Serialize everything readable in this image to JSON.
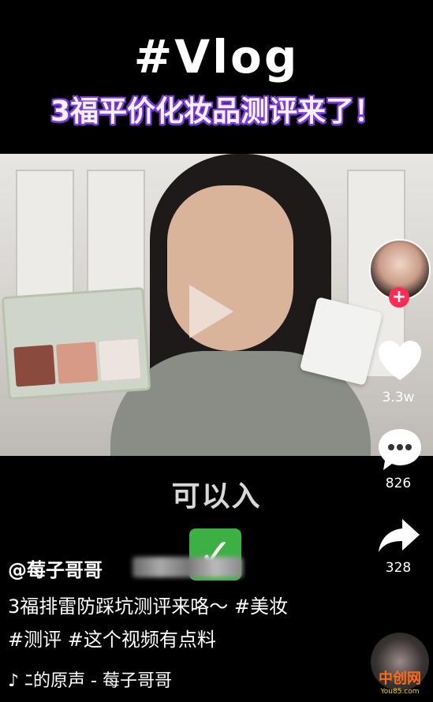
{
  "overlay": {
    "title": "#Vlog",
    "subtitle": "3福平价化妆品测评来了！"
  },
  "video": {
    "caption": "可以入",
    "check_symbol": "✓"
  },
  "post": {
    "username": "@莓子哥哥",
    "description": "3福排雷防踩坑测评来咯～ #美妆 #测评 #这个视频有点料",
    "music": "♪ ﾆ的原声 - 莓子哥哥"
  },
  "actions": {
    "follow_symbol": "+",
    "likes": "3.3w",
    "comments": "826",
    "shares": "328"
  },
  "watermark": {
    "name": "中创网",
    "url": "You85.com"
  },
  "colors": {
    "subtitle_outline": "#7a3fd6",
    "follow_badge": "#fe2c55",
    "check_green": "#3cb043"
  }
}
